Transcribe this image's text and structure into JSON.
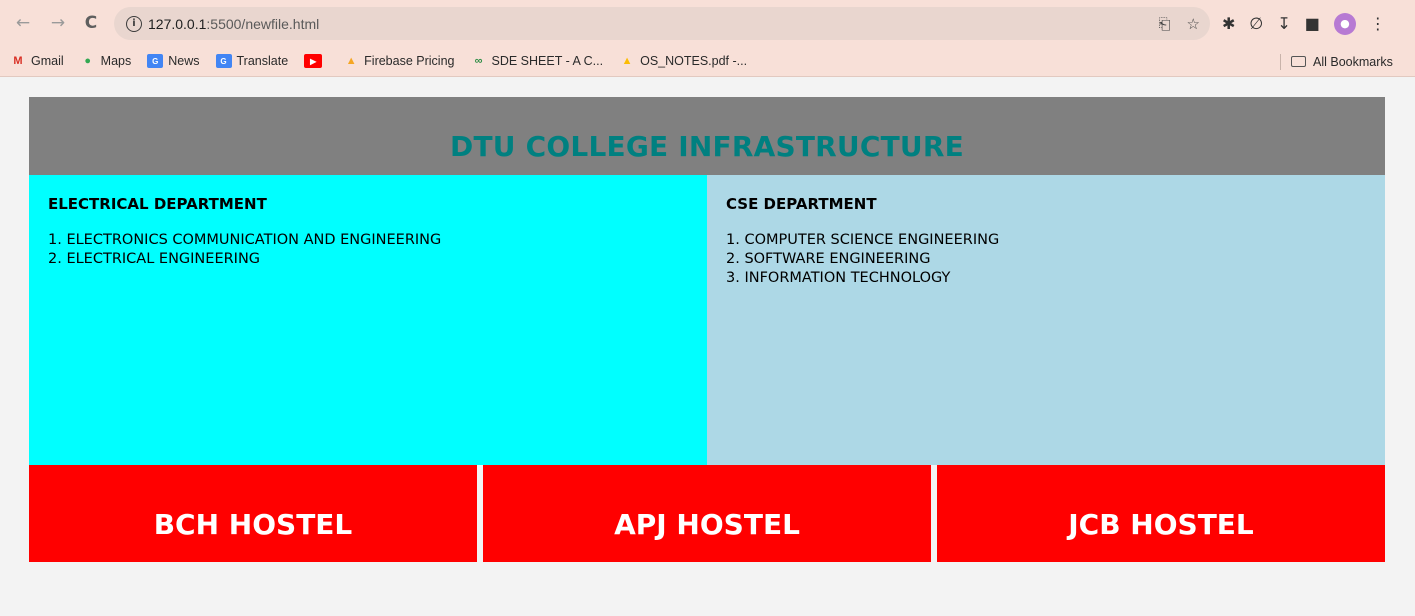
{
  "browser": {
    "url_host": "127.0.0.1",
    "url_path": ":5500/newfile.html",
    "bookmarks": [
      {
        "label": "Gmail",
        "icon": "gmail-icon"
      },
      {
        "label": "Maps",
        "icon": "maps-icon"
      },
      {
        "label": "News",
        "icon": "news-icon"
      },
      {
        "label": "Translate",
        "icon": "translate-icon"
      },
      {
        "label": "",
        "icon": "youtube-icon"
      },
      {
        "label": "Firebase Pricing",
        "icon": "firebase-icon"
      },
      {
        "label": "SDE SHEET - A C...",
        "icon": "gfg-icon"
      },
      {
        "label": "OS_NOTES.pdf -...",
        "icon": "drive-icon"
      }
    ],
    "all_bookmarks_label": "All Bookmarks"
  },
  "page": {
    "title": "DTU COLLEGE INFRASTRUCTURE",
    "departments": {
      "electrical": {
        "heading": "ELECTRICAL DEPARTMENT",
        "items": [
          "1. ELECTRONICS COMMUNICATION AND ENGINEERING",
          "2. ELECTRICAL ENGINEERING"
        ]
      },
      "cse": {
        "heading": "CSE DEPARTMENT",
        "items": [
          "1. COMPUTER SCIENCE ENGINEERING",
          "2. SOFTWARE ENGINEERING",
          "3. INFORMATION TECHNOLOGY"
        ]
      }
    },
    "hostels": [
      "BCH HOSTEL",
      "APJ HOSTEL",
      "JCB HOSTEL"
    ]
  },
  "colors": {
    "header_bg": "#808080",
    "title_color": "#008080",
    "electrical_bg": "#00ffff",
    "cse_bg": "#add8e6",
    "hostel_bg": "#ff0000"
  }
}
